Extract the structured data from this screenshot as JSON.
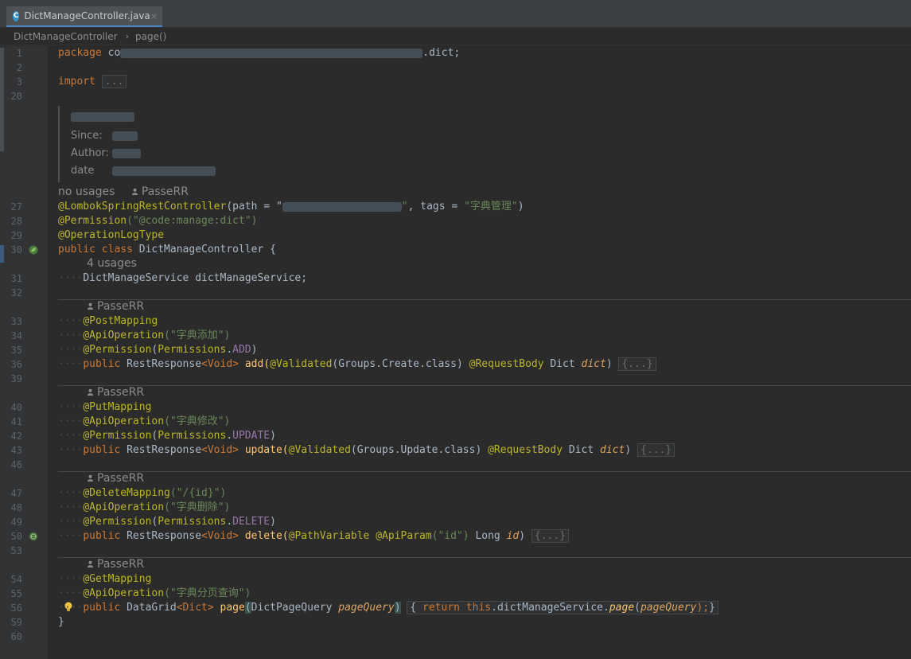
{
  "window": {
    "path_strip": ""
  },
  "tab": {
    "label": "DictManageController.java",
    "icon": "java-class-icon",
    "close": "×"
  },
  "breadcrumb": {
    "class_name": "DictManageController",
    "separator": "›",
    "method": "page()"
  },
  "doc": {
    "since_label": "Since:",
    "author_label": "Author:",
    "date_label": "date"
  },
  "hints": {
    "no_usages": "no usages",
    "author": "PasseRR",
    "four_usages": "4 usages"
  },
  "lines": {
    "l1": "1",
    "l2": "2",
    "l3": "3",
    "l20": "20",
    "l27": "27",
    "l28": "28",
    "l29": "29",
    "l30": "30",
    "l31": "31",
    "l32": "32",
    "l33": "33",
    "l34": "34",
    "l35": "35",
    "l36": "36",
    "l39": "39",
    "l40": "40",
    "l41": "41",
    "l42": "42",
    "l43": "43",
    "l46": "46",
    "l47": "47",
    "l48": "48",
    "l49": "49",
    "l50": "50",
    "l53": "53",
    "l54": "54",
    "l55": "55",
    "l56": "56",
    "l59": "59",
    "l60": "60"
  },
  "code": {
    "package_kw": "package",
    "package_tail": ".dict;",
    "import_kw": "import",
    "fold": "...",
    "lombok_ann": "@LombokSpringRestController",
    "path_attr": "(path = \"",
    "path_end": "\"",
    "tags_attr": ", tags = ",
    "tags_val": "\"字典管理\"",
    "close_paren": ")",
    "perm_ann": "@Permission",
    "perm_val": "(\"@code:manage:dict\")",
    "oplog_ann": "@OperationLogType",
    "public_class": "public class ",
    "class_name": "DictManageController",
    "open_brace": " {",
    "service_type": "DictManageService",
    "service_field": " dictManageService;",
    "post_mapping": "@PostMapping",
    "api_op": "@ApiOperation",
    "add_title": "(\"字典添加\")",
    "perm_open": "(",
    "permissions": "Permissions",
    "dot": ".",
    "add_const": "ADD",
    "update_const": "UPDATE",
    "delete_const": "DELETE",
    "public": "public ",
    "rest_response": "RestResponse",
    "void_generic": "<Void>",
    "add_sig": " add(",
    "validated": "@Validated",
    "groups_create": "(Groups.Create.class)",
    "request_body": " @RequestBody ",
    "dict_type": "Dict ",
    "dict_param": "dict",
    "fold_body": "{...}",
    "put_mapping": "@PutMapping",
    "update_title": "(\"字典修改\")",
    "update_sig": " update(",
    "groups_update": "(Groups.Update.class)",
    "delete_mapping": "@DeleteMapping",
    "delete_path": "(\"/{id}\")",
    "delete_title": "(\"字典删除\")",
    "delete_sig": " delete(",
    "path_variable": "@PathVariable",
    "api_param": " @ApiParam",
    "api_param_val": "(\"id\")",
    "long_type": " Long ",
    "id_param": "id",
    "get_mapping": "@GetMapping",
    "page_title": "(\"字典分页查询\")",
    "datagrid": "DataGrid",
    "dict_generic": "<Dict>",
    "page_name": " page",
    "page_query_type": "DictPageQuery ",
    "page_query_param": "pageQuery",
    "return_kw": "return ",
    "this_kw": "this",
    "service_ref": ".dictManageService.",
    "page_call": "page",
    "close_semi": ");",
    "brace_close": "}",
    "ws": "····"
  },
  "colors": {
    "background": "#2b2b2b",
    "keyword": "#cc7832",
    "annotation": "#bbb529",
    "string": "#6a8759",
    "constant": "#9876aa",
    "parameter": "#e0a55e",
    "method": "#ffc66d"
  }
}
